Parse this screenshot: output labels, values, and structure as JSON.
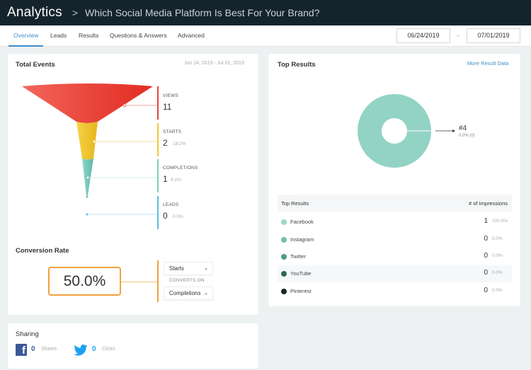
{
  "header": {
    "app": "Analytics",
    "separator": ">",
    "title": "Which Social Media Platform Is Best For Your Brand?"
  },
  "tabs": [
    {
      "label": "Overview",
      "active": true
    },
    {
      "label": "Leads",
      "active": false
    },
    {
      "label": "Results",
      "active": false
    },
    {
      "label": "Questions & Answers",
      "active": false
    },
    {
      "label": "Advanced",
      "active": false
    }
  ],
  "date_range": {
    "start": "06/24/2019",
    "arrow": "→",
    "end": "07/01/2019"
  },
  "total_events": {
    "title": "Total Events",
    "range": "Jun 24, 2019 - Jul 01, 2019",
    "stages": [
      {
        "label": "VIEWS",
        "value": "11",
        "percent": "",
        "color": "#e8453c"
      },
      {
        "label": "STARTS",
        "value": "2",
        "percent": "18.2%",
        "color": "#f3c834"
      },
      {
        "label": "COMPLETIONS",
        "value": "1",
        "percent": "9.1%",
        "color": "#7ecfc0"
      },
      {
        "label": "LEADS",
        "value": "0",
        "percent": "0.0%",
        "color": "#5bbfdf"
      }
    ]
  },
  "conversion": {
    "title": "Conversion Rate",
    "rate": "50.0%",
    "from": "Starts",
    "converts_on_label": "CONVERTS ON",
    "to": "Completions",
    "accent": "#f0a23e"
  },
  "sharing": {
    "title": "Sharing",
    "facebook_count": "0",
    "facebook_label": "Shares",
    "twitter_count": "0",
    "twitter_label": "Clicks"
  },
  "top_results": {
    "title": "Top Results",
    "more_link": "More Result Data",
    "callout_title": "#4",
    "callout_sub": "0.0% (0)",
    "table_header": {
      "left": "Top Results",
      "right": "# of Impressions"
    },
    "rows": [
      {
        "name": "Facebook",
        "count": "1",
        "percent": "100.0%",
        "color": "#9ed8c8"
      },
      {
        "name": "Instagram",
        "count": "0",
        "percent": "0.0%",
        "color": "#72c2a6"
      },
      {
        "name": "Twitter",
        "count": "0",
        "percent": "0.0%",
        "color": "#4a9e84"
      },
      {
        "name": "YouTube",
        "count": "0",
        "percent": "0.0%",
        "color": "#2e6654"
      },
      {
        "name": "Pinterest",
        "count": "0",
        "percent": "0.0%",
        "color": "#15291f"
      }
    ]
  }
}
